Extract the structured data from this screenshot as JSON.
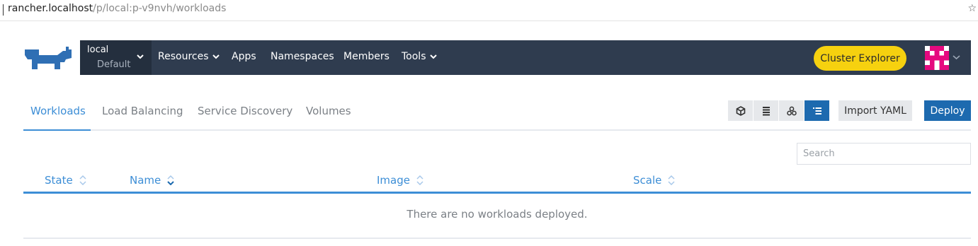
{
  "browser": {
    "url_host": "rancher.localhost",
    "url_path": "/p/local:p-v9nvh/workloads",
    "bookmark_icon": "star-icon"
  },
  "header": {
    "logo_icon": "rancher-cow-logo",
    "cluster": "local",
    "project": "Default",
    "nav": [
      {
        "label": "Resources",
        "dropdown": true
      },
      {
        "label": "Apps",
        "dropdown": false
      },
      {
        "label": "Namespaces",
        "dropdown": false
      },
      {
        "label": "Members",
        "dropdown": false
      },
      {
        "label": "Tools",
        "dropdown": true
      }
    ],
    "cluster_explorer_label": "Cluster Explorer",
    "avatar_icon": "identicon-avatar"
  },
  "tabs": {
    "items": [
      "Workloads",
      "Load Balancing",
      "Service Discovery",
      "Volumes"
    ],
    "active": "Workloads"
  },
  "toolbar": {
    "view_modes": [
      "cube-icon",
      "list-flat-icon",
      "nodes-icon",
      "list-grouped-icon"
    ],
    "active_view": "list-grouped-icon",
    "import_label": "Import YAML",
    "deploy_label": "Deploy"
  },
  "search": {
    "placeholder": "Search",
    "value": ""
  },
  "table": {
    "columns": [
      "State",
      "Name",
      "Image",
      "Scale"
    ],
    "sorted_column": "Name",
    "empty_message": "There are no workloads deployed."
  },
  "colors": {
    "nav_bg": "#2f3c4f",
    "accent": "#3d8ed6",
    "primary": "#1d6aaf",
    "explorer": "#f6d10f",
    "avatar": "#e5097f"
  }
}
